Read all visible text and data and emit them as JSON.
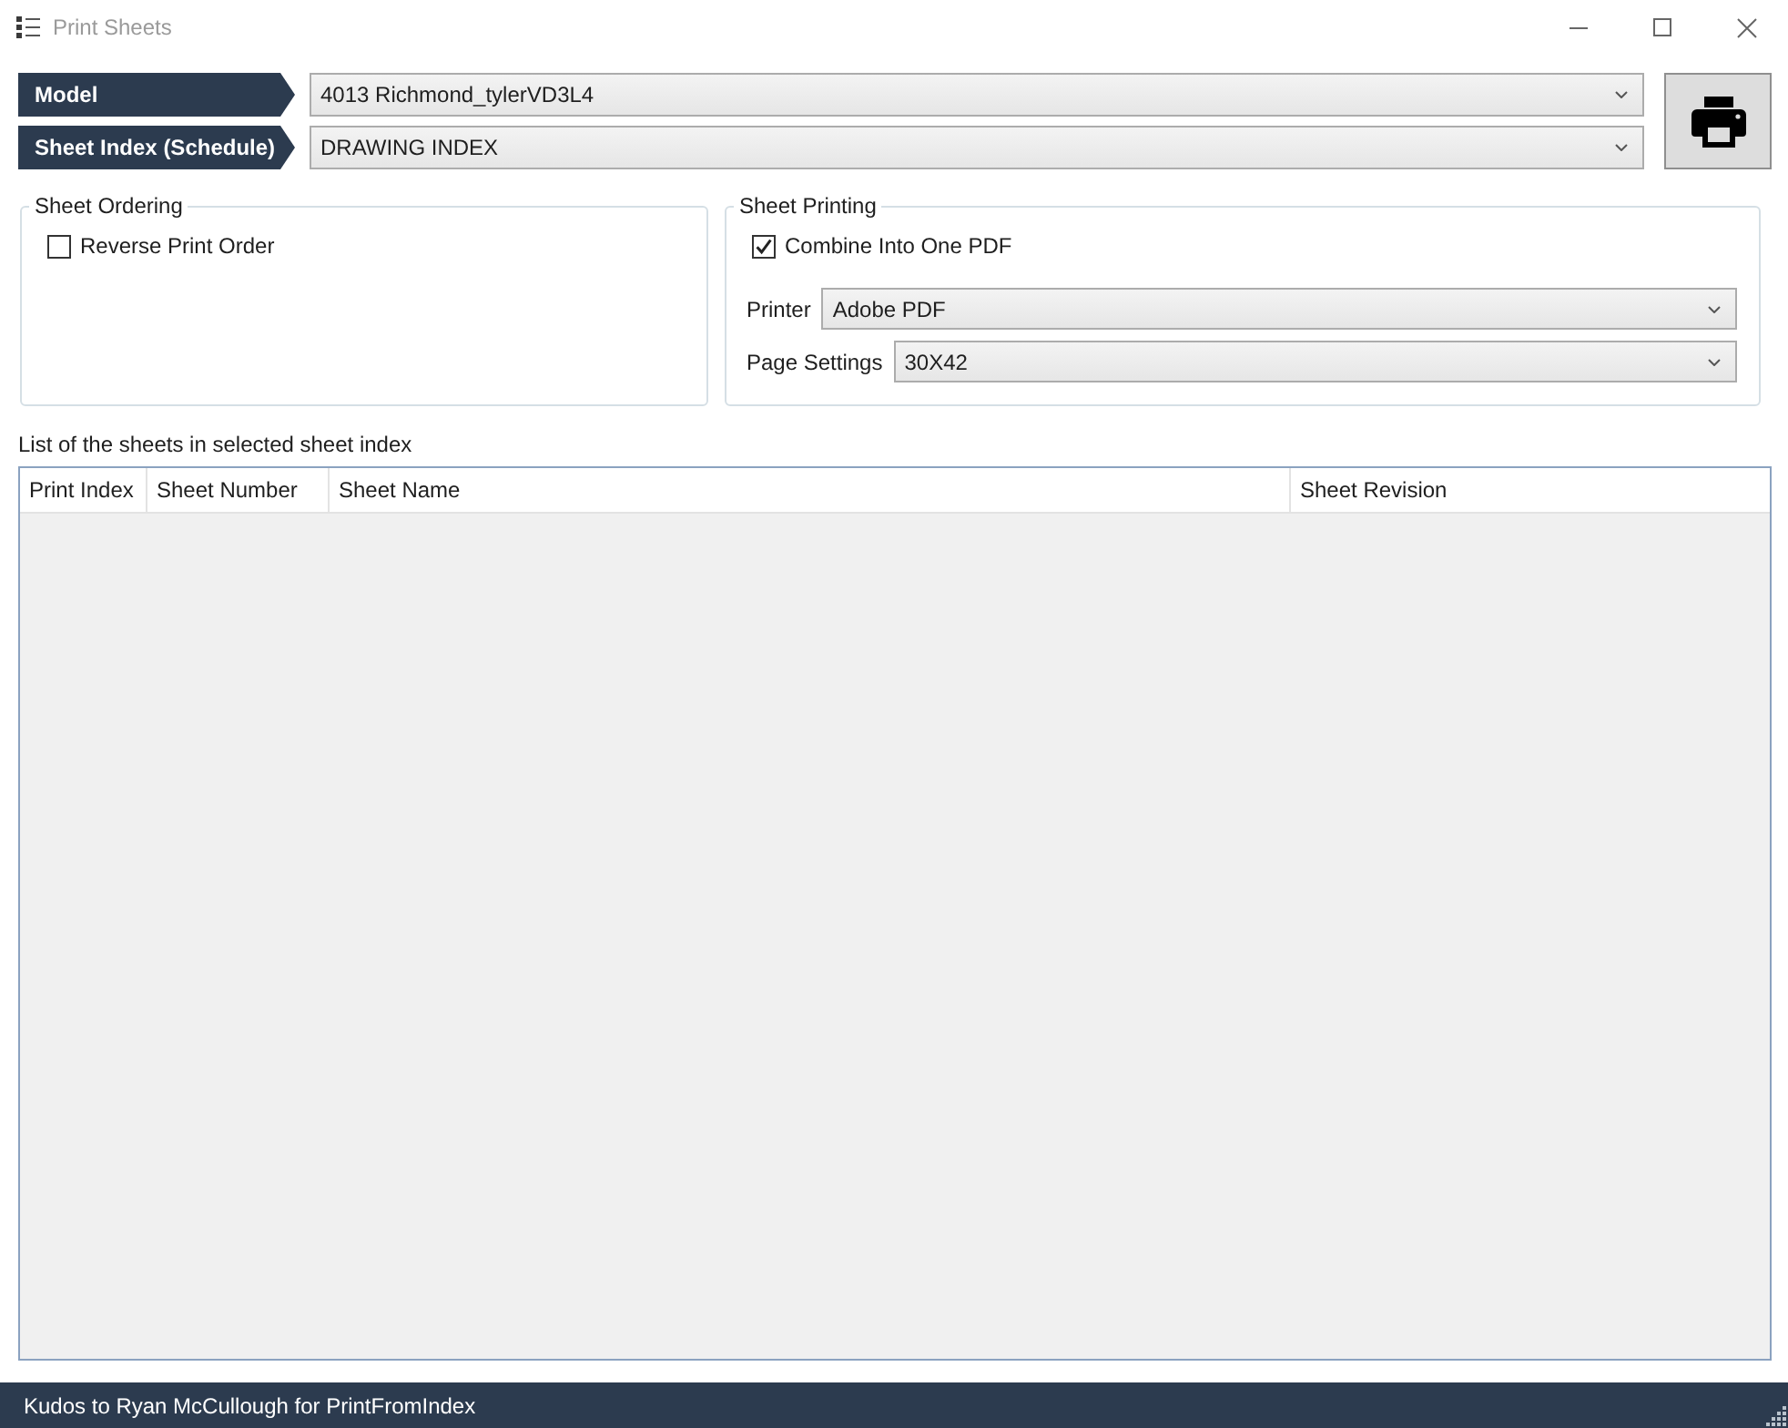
{
  "window": {
    "title": "Print Sheets"
  },
  "selectors": [
    {
      "label": "Model",
      "value": "4013 Richmond_tylerVD3L4"
    },
    {
      "label": "Sheet Index (Schedule)",
      "value": "DRAWING INDEX"
    }
  ],
  "sheet_ordering": {
    "title": "Sheet Ordering",
    "options": [
      {
        "label": "Reverse Print Order",
        "checked": false
      }
    ]
  },
  "sheet_printing": {
    "title": "Sheet Printing",
    "options": [
      {
        "label": "Combine Into One PDF",
        "checked": true
      }
    ],
    "fields": [
      {
        "label": "Printer",
        "value": "Adobe PDF"
      },
      {
        "label": "Page Settings",
        "value": "30X42"
      }
    ]
  },
  "sheet_list": {
    "caption": "List of the sheets in selected sheet index",
    "columns": [
      "Print Index",
      "Sheet Number",
      "Sheet Name",
      "Sheet Revision"
    ]
  },
  "status_bar": {
    "text": "Kudos to Ryan McCullough for PrintFromIndex"
  }
}
